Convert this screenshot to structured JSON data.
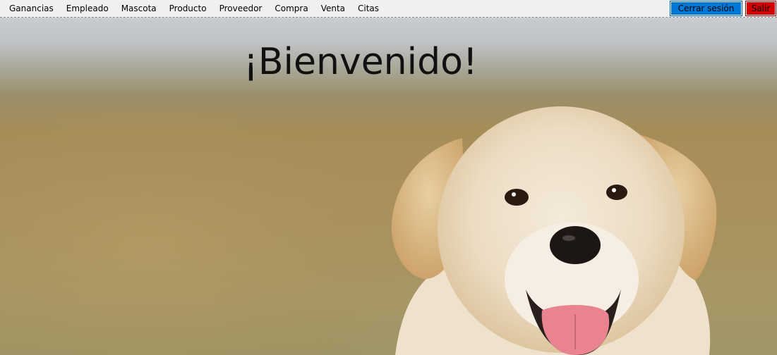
{
  "menu": {
    "items": [
      "Ganancias",
      "Empleado",
      "Mascota",
      "Producto",
      "Proveedor",
      "Compra",
      "Venta",
      "Citas"
    ]
  },
  "buttons": {
    "logout_label": "Cerrar sesión",
    "exit_label": "Salir"
  },
  "hero": {
    "title": "¡Bienvenido!",
    "image": "puppy-photo"
  },
  "colors": {
    "logout_button": "#0078d7",
    "exit_button": "#d40000",
    "menubar": "#f0f0f0"
  }
}
